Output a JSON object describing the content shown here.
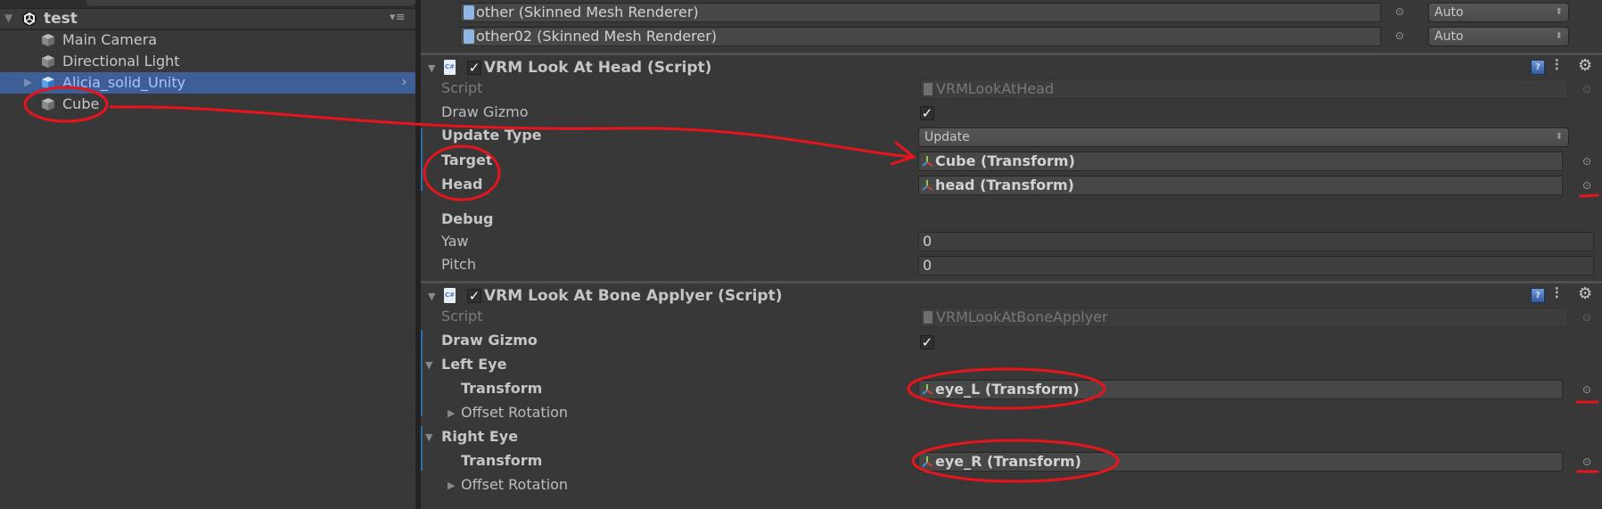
{
  "hierarchy": {
    "scene_name": "test",
    "items": [
      {
        "label": "Main Camera",
        "selected": false,
        "expandable": false
      },
      {
        "label": "Directional Light",
        "selected": false,
        "expandable": false
      },
      {
        "label": "Alicia_solid_Unity",
        "selected": true,
        "expandable": true
      },
      {
        "label": "Cube",
        "selected": false,
        "expandable": false
      }
    ],
    "menu_icon": "hamburger-menu-icon"
  },
  "inspector": {
    "renderers": [
      {
        "value": "other (Skinned Mesh Renderer)",
        "dropdown": "Auto"
      },
      {
        "value": "other02 (Skinned Mesh Renderer)",
        "dropdown": "Auto"
      }
    ],
    "look_at_head": {
      "title": "VRM Look At Head (Script)",
      "enabled": true,
      "script_label": "Script",
      "script_value": "VRMLookAtHead",
      "draw_gizmo_label": "Draw Gizmo",
      "draw_gizmo": true,
      "update_type_label": "Update Type",
      "update_type_value": "Update",
      "target_label": "Target",
      "target_value": "Cube (Transform)",
      "head_label": "Head",
      "head_value": "head (Transform)",
      "debug_label": "Debug",
      "yaw_label": "Yaw",
      "yaw_value": "0",
      "pitch_label": "Pitch",
      "pitch_value": "0"
    },
    "bone_applyer": {
      "title": "VRM Look At Bone Applyer (Script)",
      "enabled": true,
      "script_label": "Script",
      "script_value": "VRMLookAtBoneApplyer",
      "draw_gizmo_label": "Draw Gizmo",
      "draw_gizmo": true,
      "left_eye_label": "Left Eye",
      "left_transform_label": "Transform",
      "left_transform_value": "eye_L (Transform)",
      "left_offset_label": "Offset Rotation",
      "right_eye_label": "Right Eye",
      "right_transform_label": "Transform",
      "right_transform_value": "eye_R (Transform)",
      "right_offset_label": "Offset Rotation"
    },
    "csharp_glyph": "C#",
    "help_glyph": "?",
    "check_glyph": "✓",
    "gear_glyph": "⚙",
    "presets_glyph": "⫶",
    "target_glyph": "⊙"
  },
  "colors": {
    "background": "#383838",
    "selection": "#3e5f96",
    "annotation_red": "#e8141c",
    "modified_bar": "#2c6ea8"
  }
}
